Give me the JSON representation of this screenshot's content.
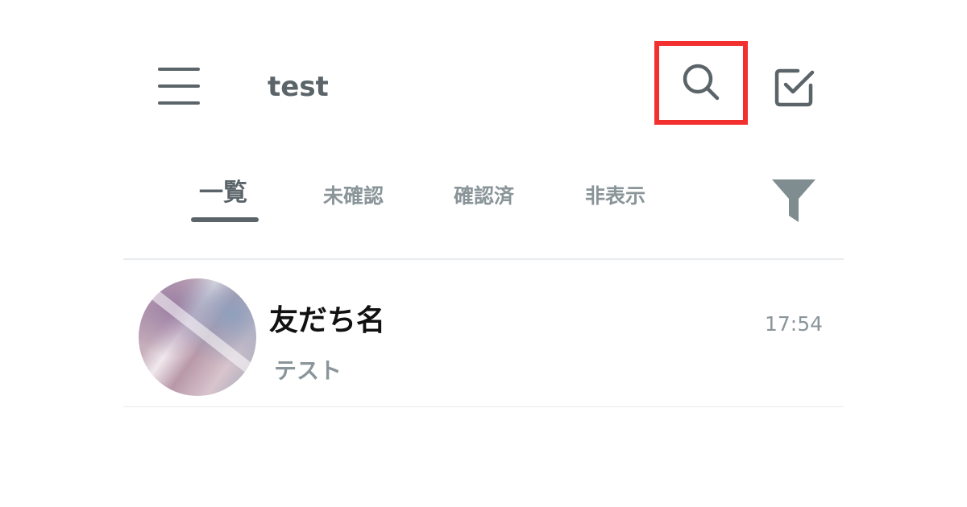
{
  "header": {
    "title": "test",
    "menu_icon": "hamburger-menu-icon",
    "search_icon": "search-icon",
    "compose_icon": "checkbox-edit-icon",
    "highlight_color": "#f2302f"
  },
  "tabs": [
    {
      "label": "一覧",
      "active": true
    },
    {
      "label": "未確認",
      "active": false
    },
    {
      "label": "確認済",
      "active": false
    },
    {
      "label": "非表示",
      "active": false
    }
  ],
  "filter_icon": "filter-icon",
  "chats": [
    {
      "name": "友だち名",
      "last_message": "テスト",
      "time": "17:54"
    }
  ],
  "colors": {
    "text_primary": "#5a6469",
    "text_secondary": "#8a9599",
    "name_text": "#111111",
    "divider": "#e8ecee"
  }
}
